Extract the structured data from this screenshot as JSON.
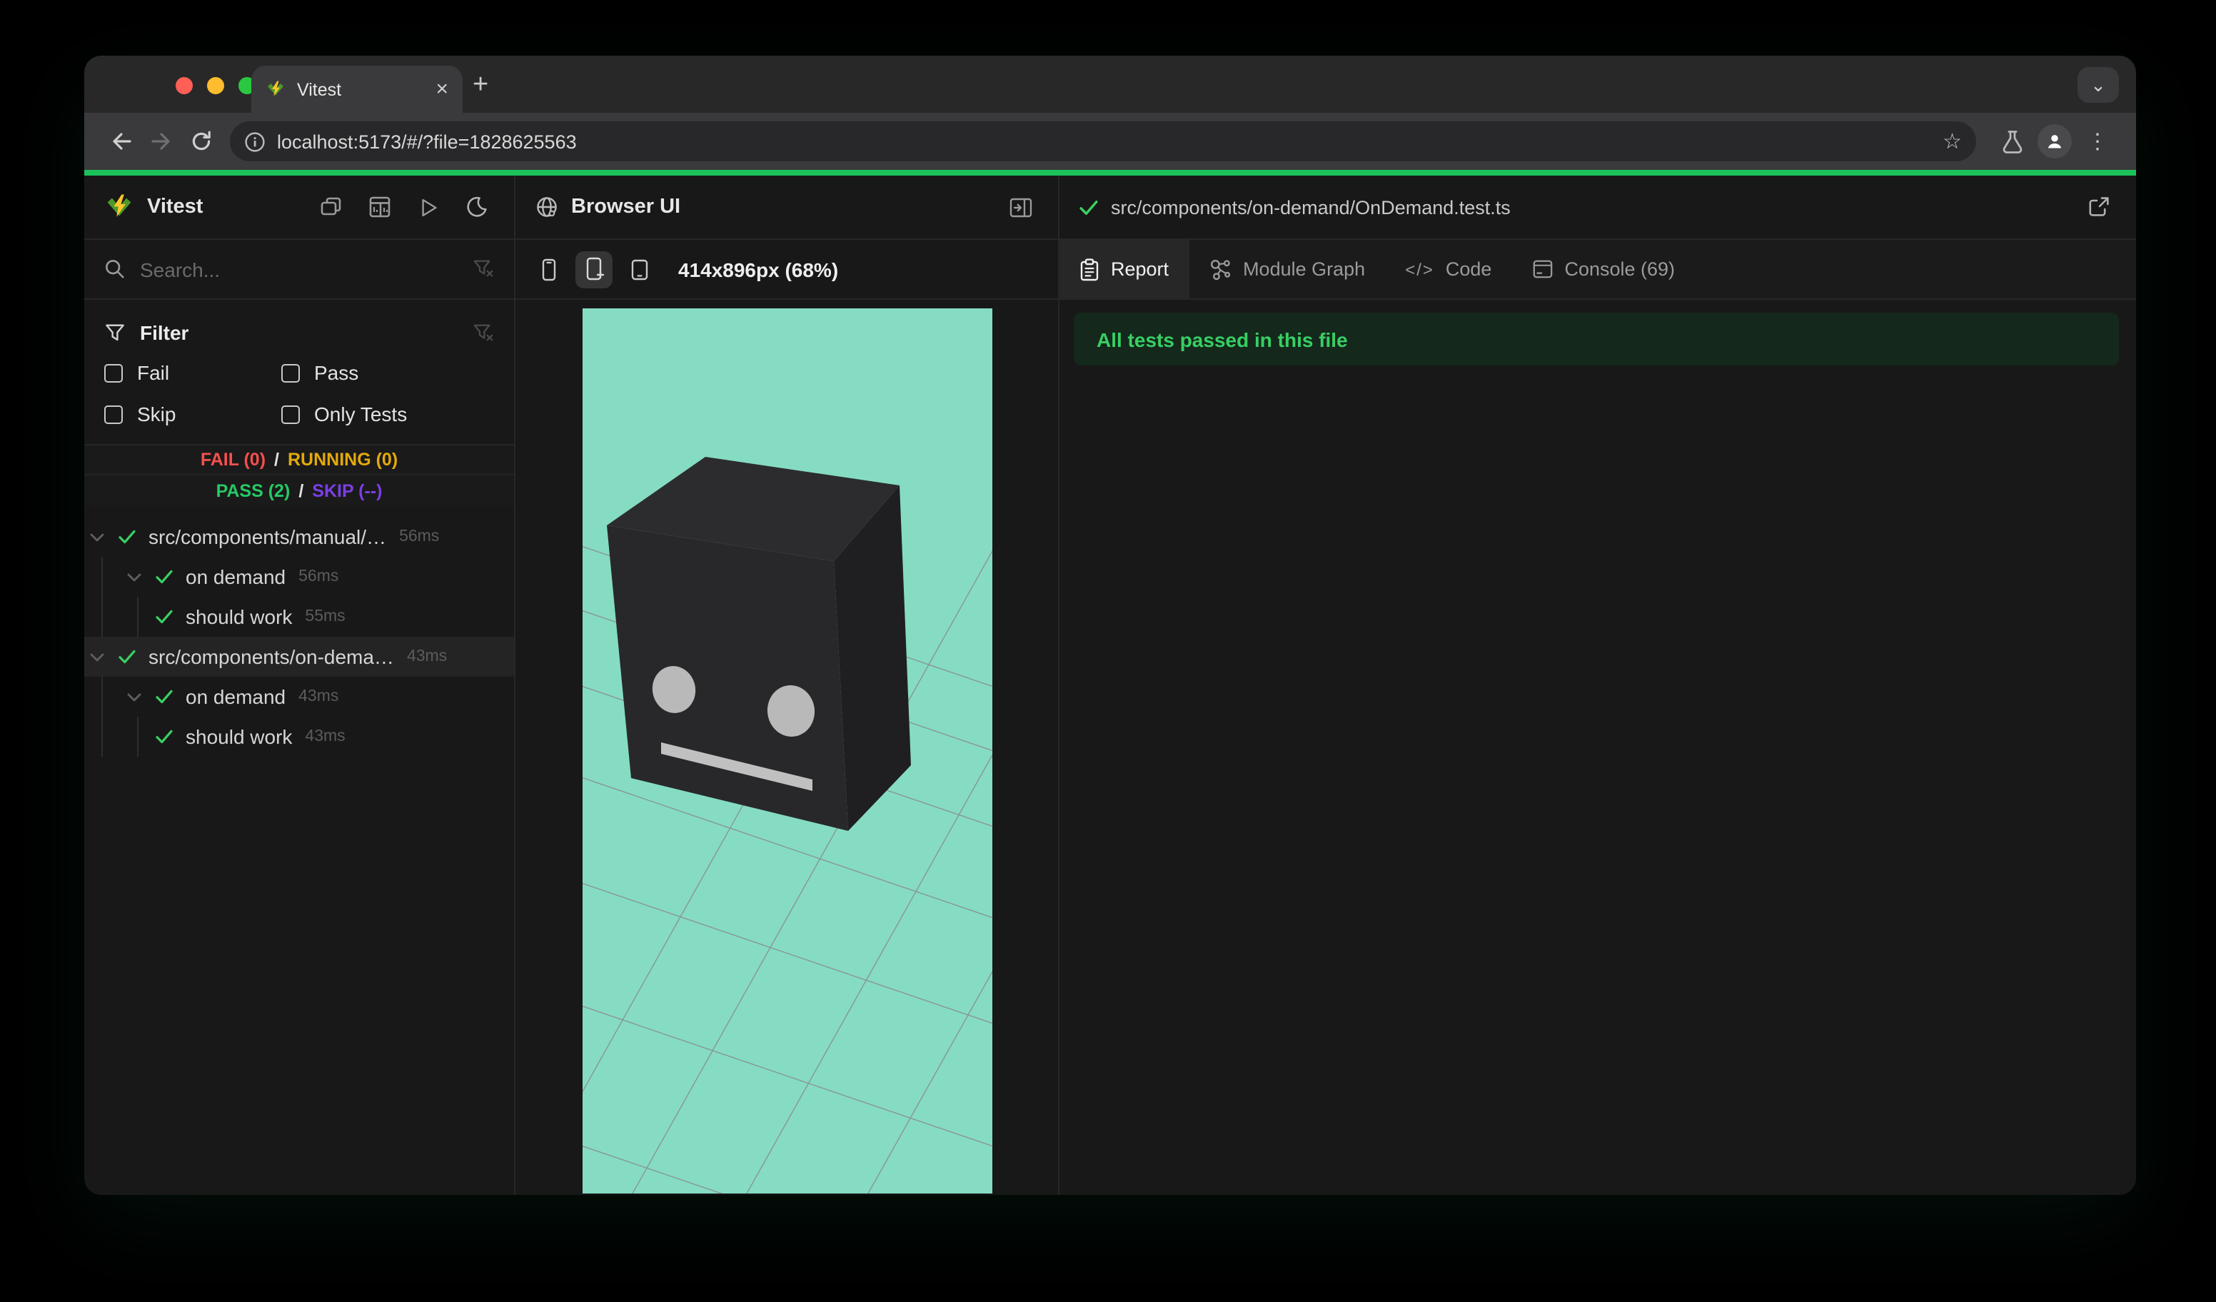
{
  "browser_chrome": {
    "tab_title": "Vitest",
    "url": "localhost:5173/#/?file=1828625563",
    "close_glyph": "×",
    "new_tab_glyph": "+",
    "window_chevron_glyph": "⌄",
    "star_glyph": "☆",
    "more_glyph": "⋮"
  },
  "sidebar": {
    "app_title": "Vitest",
    "search_placeholder": "Search...",
    "filter": {
      "title": "Filter",
      "fail": "Fail",
      "pass": "Pass",
      "skip": "Skip",
      "only_tests": "Only Tests"
    },
    "summary": {
      "fail": "FAIL (0)",
      "running": "RUNNING (0)",
      "pass": "PASS (2)",
      "skip": "SKIP (--)",
      "separator": "/"
    },
    "tree": [
      {
        "kind": "file",
        "name": "src/components/manual/…",
        "duration": "56ms"
      },
      {
        "kind": "suite",
        "name": "on demand",
        "duration": "56ms"
      },
      {
        "kind": "test",
        "name": "should work",
        "duration": "55ms"
      },
      {
        "kind": "file",
        "name": "src/components/on-dema…",
        "duration": "43ms",
        "selected": true
      },
      {
        "kind": "suite",
        "name": "on demand",
        "duration": "43ms"
      },
      {
        "kind": "test",
        "name": "should work",
        "duration": "43ms"
      }
    ]
  },
  "browser_panel": {
    "title": "Browser UI",
    "size_label": "414x896px (68%)"
  },
  "right_panel": {
    "file_path": "src/components/on-demand/OnDemand.test.ts",
    "tabs": {
      "report": "Report",
      "module_graph": "Module Graph",
      "code": "Code",
      "console": "Console (69)"
    },
    "banner": "All tests passed in this file"
  },
  "colors": {
    "progress_green": "#1bc25a",
    "fail_red": "#f5504d",
    "running_yellow": "#e3a90c",
    "pass_green": "#26c965",
    "skip_purple": "#7b3fe4",
    "check_green": "#3ccf63",
    "banner_bg": "#14281c",
    "banner_text": "#38cf63",
    "viewport_bg": "#85dcc3",
    "grid_line": "#8a8a8a",
    "cube_top": "#2c2c2e",
    "cube_front": "#28282a",
    "cube_side": "#1f1f21",
    "cube_eye": "#b9b9b9",
    "cube_mouth": "#c0c0c0"
  }
}
